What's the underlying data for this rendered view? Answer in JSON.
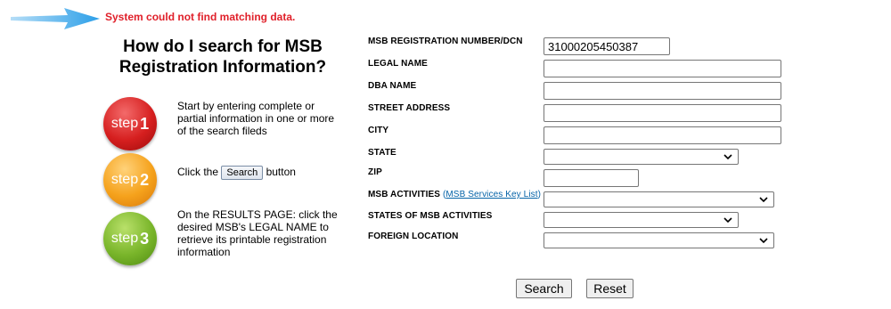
{
  "message": {
    "error": "System could not find matching data."
  },
  "colors": {
    "arrow": "#2c9fe8",
    "error": "#e0202a",
    "link": "#0563a8"
  },
  "howto": {
    "title_line1": "How do I search for MSB",
    "title_line2": "Registration Information?",
    "steps": [
      {
        "word": "step",
        "num": "1",
        "text": "Start by entering complete or partial information in one or more of the search fileds"
      },
      {
        "word": "step",
        "num": "2",
        "text_before": "Click the",
        "button": "Search",
        "text_after": "button"
      },
      {
        "word": "step",
        "num": "3",
        "text": "On the RESULTS PAGE: click the desired MSB's LEGAL NAME to retrieve its printable registration information"
      }
    ]
  },
  "form": {
    "reg_number": {
      "label": "MSB REGISTRATION NUMBER/DCN",
      "value": "31000205450387"
    },
    "legal_name": {
      "label": "LEGAL NAME",
      "value": ""
    },
    "dba_name": {
      "label": "DBA NAME",
      "value": ""
    },
    "street": {
      "label": "STREET ADDRESS",
      "value": ""
    },
    "city": {
      "label": "CITY",
      "value": ""
    },
    "state": {
      "label": "STATE",
      "value": ""
    },
    "zip": {
      "label": "ZIP",
      "value": ""
    },
    "activities": {
      "label": "MSB ACTIVITIES",
      "link_open": "(",
      "link": "MSB Services Key List",
      "link_close": ")",
      "value": ""
    },
    "activity_states": {
      "label": "STATES OF MSB ACTIVITIES",
      "value": ""
    },
    "foreign": {
      "label": "FOREIGN LOCATION",
      "value": ""
    }
  },
  "buttons": {
    "search": "Search",
    "reset": "Reset"
  }
}
